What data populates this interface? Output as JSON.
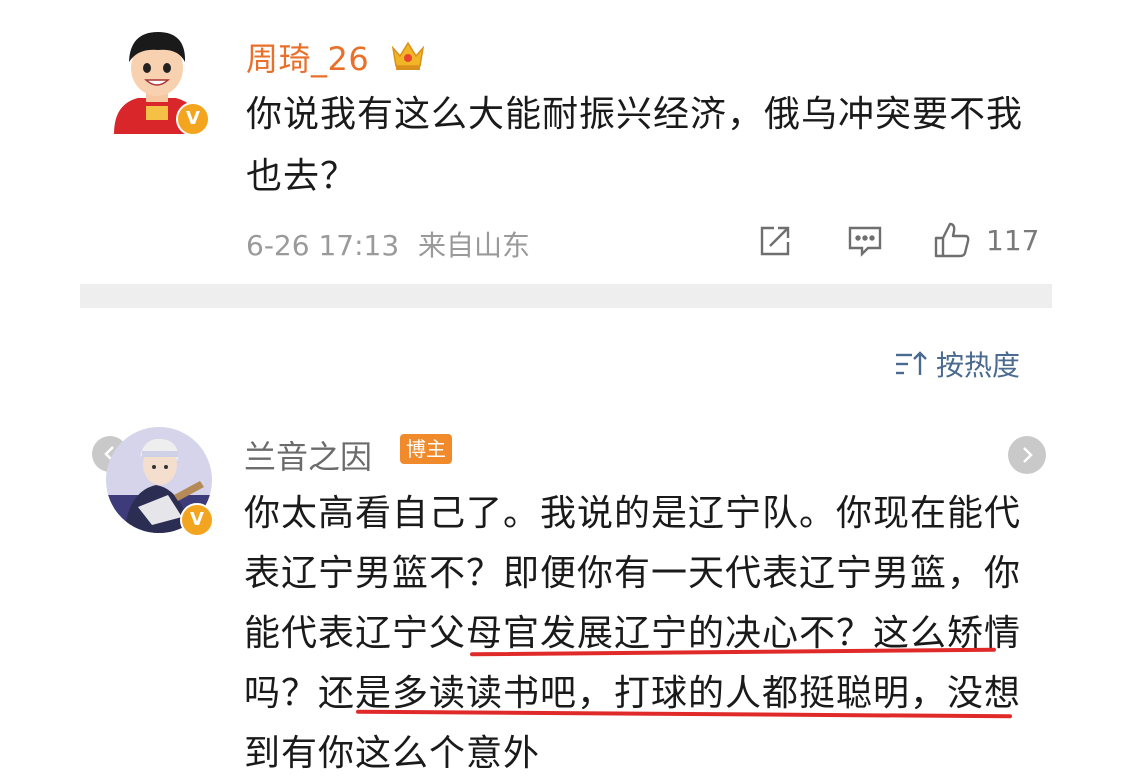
{
  "comments": [
    {
      "username": "周琦_26",
      "text": "你说我有这么大能耐振兴经济，俄乌冲突要不我也去？",
      "date": "6-26 17:13",
      "location": "来自山东",
      "likes": "117",
      "avatar_icon": "cartoon-avatar-icon",
      "crown_icon": "crown-icon"
    },
    {
      "username": "兰音之因",
      "badge": "博主",
      "text": "你太高看自己了。我说的是辽宁队。你现在能代表辽宁男篮不？即便你有一天代表辽宁男篮，你能代表辽宁父母官发展辽宁的决心不？这么矫情吗？还是多读读书吧，打球的人都挺聪明，没想到有你这么个意外",
      "avatar_icon": "cartoon-avatar-icon"
    }
  ],
  "sort": {
    "label": "按热度",
    "icon": "sort-icon"
  },
  "colors": {
    "username_orange": "#e8702a",
    "verified_badge": "#f3a51f",
    "underline_red": "#e02a2a",
    "sort_blue": "#4a6a90",
    "blogger_badge": "#f08a2a"
  }
}
